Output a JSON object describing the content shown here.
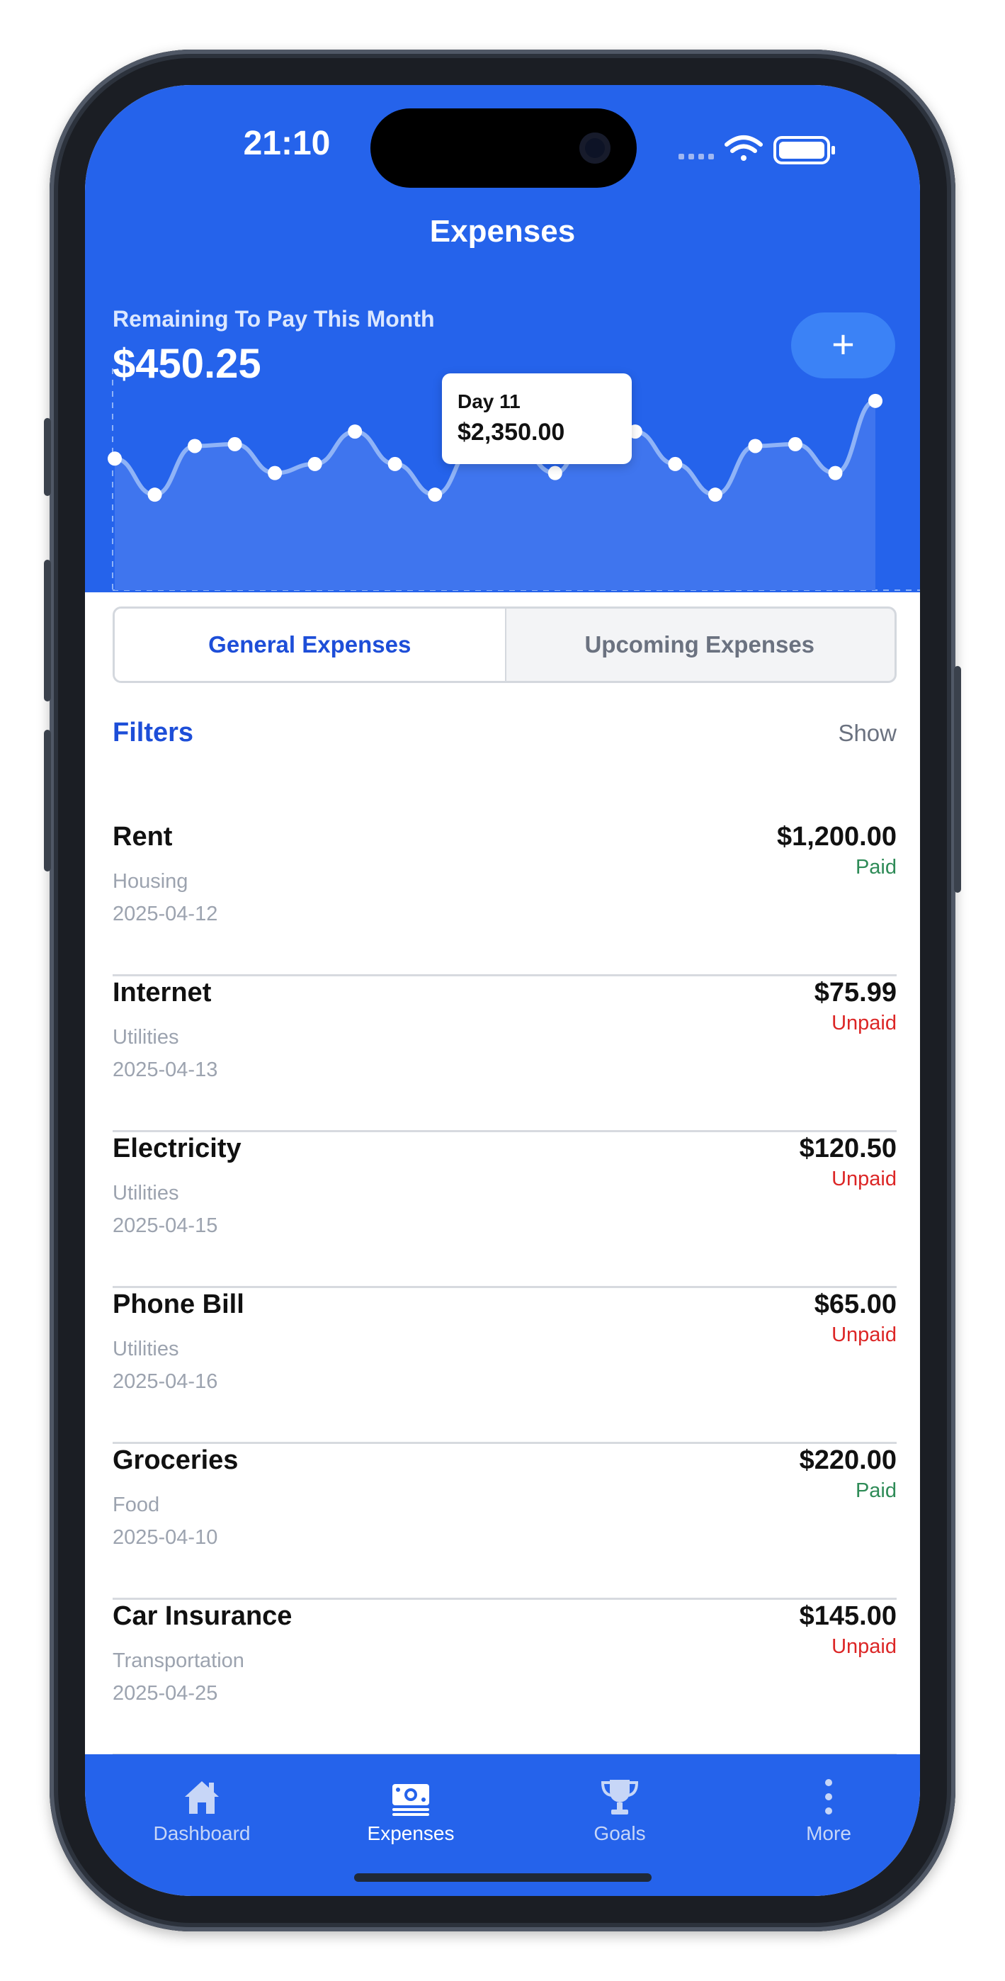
{
  "status_bar": {
    "time": "21:10"
  },
  "header": {
    "title": "Expenses",
    "remaining_label": "Remaining To Pay This Month",
    "remaining_amount": "$450.25",
    "add_button": "+"
  },
  "chart_data": {
    "type": "area",
    "x": [
      1,
      2,
      3,
      4,
      5,
      6,
      7,
      8,
      9,
      10,
      11,
      12,
      13,
      14,
      15,
      16,
      17,
      18,
      19,
      20
    ],
    "values": [
      2100,
      1900,
      2170,
      2180,
      2020,
      2070,
      2250,
      2070,
      1900,
      2170,
      2180,
      2020,
      2350,
      2250,
      2070,
      1900,
      2170,
      2180,
      2020,
      2420
    ],
    "tooltip": {
      "day_label": "Day 11",
      "value_label": "$2,350.00"
    },
    "grid": false,
    "colors": {
      "line": "#8fb3f7",
      "point": "#ffffff",
      "fill": "#3f75ee"
    }
  },
  "segmented": {
    "active": "General Expenses",
    "inactive": "Upcoming Expenses"
  },
  "filters": {
    "title": "Filters",
    "toggle": "Show"
  },
  "expenses": [
    {
      "name": "Rent",
      "category": "Housing",
      "date": "2025-04-12",
      "amount": "$1,200.00",
      "status": "Paid"
    },
    {
      "name": "Internet",
      "category": "Utilities",
      "date": "2025-04-13",
      "amount": "$75.99",
      "status": "Unpaid"
    },
    {
      "name": "Electricity",
      "category": "Utilities",
      "date": "2025-04-15",
      "amount": "$120.50",
      "status": "Unpaid"
    },
    {
      "name": "Phone Bill",
      "category": "Utilities",
      "date": "2025-04-16",
      "amount": "$65.00",
      "status": "Unpaid"
    },
    {
      "name": "Groceries",
      "category": "Food",
      "date": "2025-04-10",
      "amount": "$220.00",
      "status": "Paid"
    },
    {
      "name": "Car Insurance",
      "category": "Transportation",
      "date": "2025-04-25",
      "amount": "$145.00",
      "status": "Unpaid"
    }
  ],
  "tabbar": {
    "items": [
      {
        "label": "Dashboard",
        "icon": "home-icon"
      },
      {
        "label": "Expenses",
        "icon": "money-icon"
      },
      {
        "label": "Goals",
        "icon": "trophy-icon"
      },
      {
        "label": "More",
        "icon": "more-vertical-icon"
      }
    ],
    "active": "Expenses"
  },
  "colors": {
    "brand": "#2563eb",
    "paid": "#2e8b57",
    "unpaid": "#dc2626",
    "accent_text": "#1d4ed8"
  }
}
